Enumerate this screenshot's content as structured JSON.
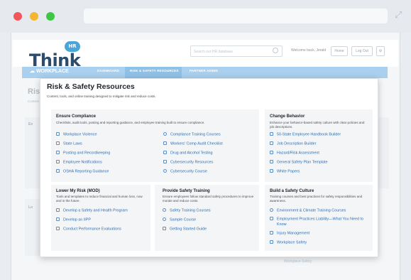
{
  "site": {
    "logo_text": "Think",
    "logo_badge": "HR",
    "search_placeholder": "Search our HR database",
    "welcome": "Welcome back, Jerald",
    "buttons": [
      "Home",
      "Log Out",
      "⚙"
    ]
  },
  "nav": {
    "workplace": "WORKPLACE",
    "items": [
      "DASHBOARD",
      "RISK & SAFETY RESOURCES",
      "PARTNER ADMIN"
    ]
  },
  "background": {
    "title": "Risk",
    "subtitle": "Content",
    "ghost_links": [
      "Ex",
      "Lo",
      "Workplace Safety"
    ]
  },
  "dropdown": {
    "title": "Risk & Safety Resources",
    "subtitle": "Content, tools, and online training designed to mitigate risk and reduce costs.",
    "compliance": {
      "title": "Ensure Compliance",
      "desc": "Checklists, audit tools, posting and reporting guidance, and employee training built to ensure compliance.",
      "col1": [
        "Workplace Violence",
        "State Laws",
        "Posting and Recordkeeping",
        "Employee Notifications",
        "OSHA Reporting Guidance"
      ],
      "col2": [
        "Compliance Training Courses",
        "Workers' Comp Audit Checklist",
        "Drug and Alcohol Testing",
        "Cybersecurity Resources",
        "Cybersecurity Course"
      ]
    },
    "behavior": {
      "title": "Change Behavior",
      "desc": "Enhance your behavior-based safety culture with clear policies and job descriptions.",
      "links": [
        "50-State Employee Handbook Builder",
        "Job Description Builder",
        "Hazard/Risk Assessment",
        "General Safety Plan Template",
        "White Papers"
      ]
    },
    "risk": {
      "title": "Lower My Risk (MOD)",
      "desc": "Tools and templates to reduce financial and human loss, now and in the future.",
      "links": [
        "Develop a Safety and Health Program",
        "Develop an IIPP",
        "Conduct Performance Evaluations"
      ]
    },
    "training": {
      "title": "Provide Safety Training",
      "desc": "Ensure employees follow standard safety procedures to improve morale and reduce costs.",
      "links": [
        "Safety Training Courses",
        "Sample Course",
        "Getting Started Guide"
      ]
    },
    "culture": {
      "title": "Build a Safety Culture",
      "desc": "Training courses and best practices for safety responsibilities and awareness.",
      "links": [
        "Environment & Climate Training Courses",
        "Employment Practices Liability—What You Need to Know",
        "Injury Management",
        "Workplace Safety"
      ]
    }
  }
}
